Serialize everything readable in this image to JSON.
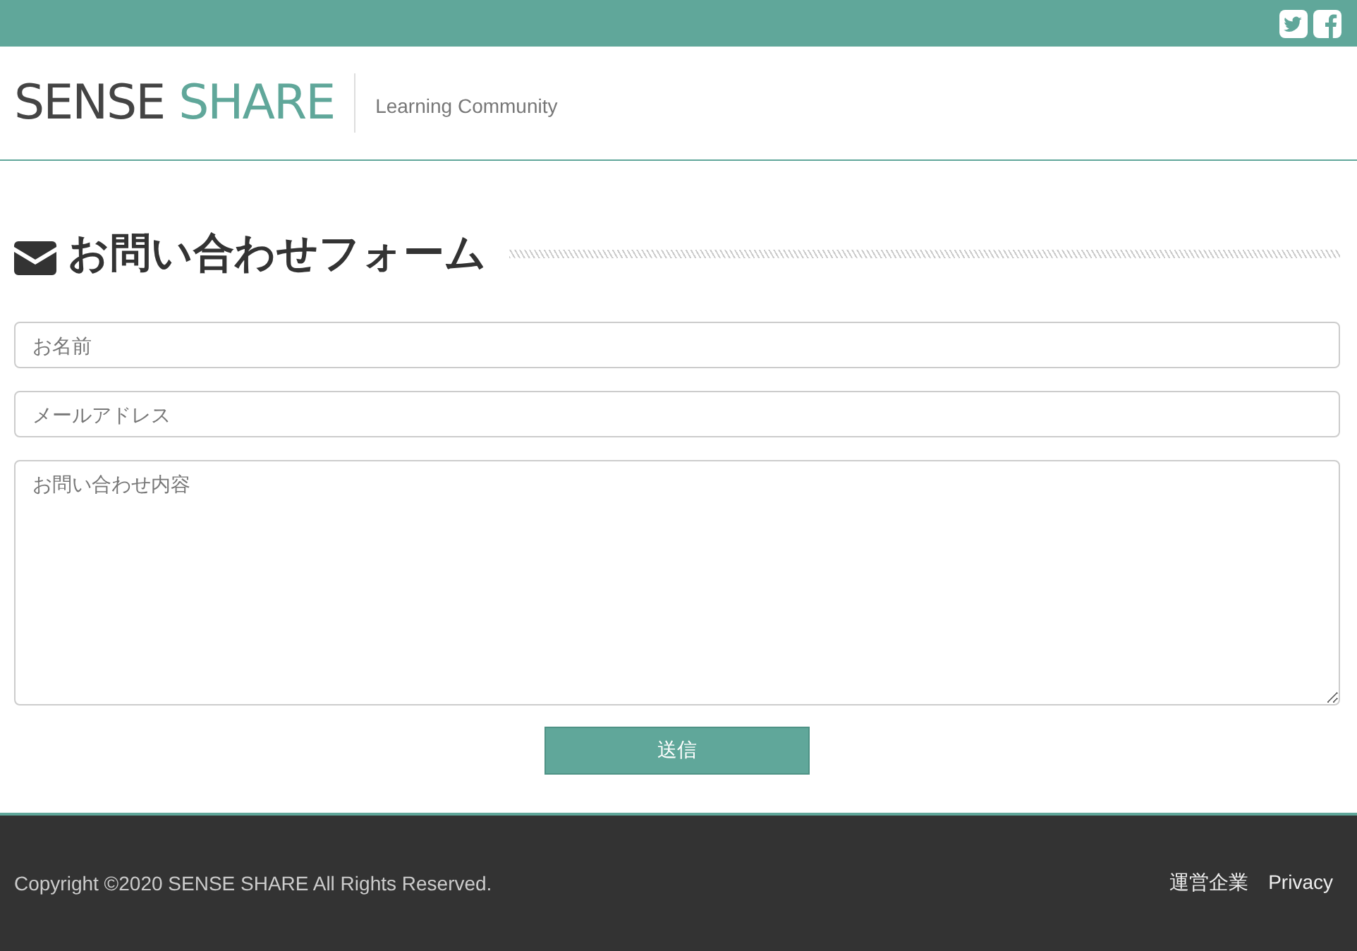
{
  "header": {
    "logo": {
      "primary": "SENSE",
      "accent": "SHARE"
    },
    "tagline": "Learning Community"
  },
  "form": {
    "title": "お問い合わせフォーム",
    "fields": [
      {
        "kind": "text",
        "placeholder": "お名前"
      },
      {
        "kind": "text",
        "placeholder": "メールアドレス"
      },
      {
        "kind": "textarea",
        "placeholder": "お問い合わせ内容"
      }
    ],
    "submit": "送信"
  },
  "footer": {
    "copyright": "Copyright ©2020 SENSE SHARE All Rights Reserved.",
    "links": [
      "運営企業",
      "Privacy"
    ]
  }
}
